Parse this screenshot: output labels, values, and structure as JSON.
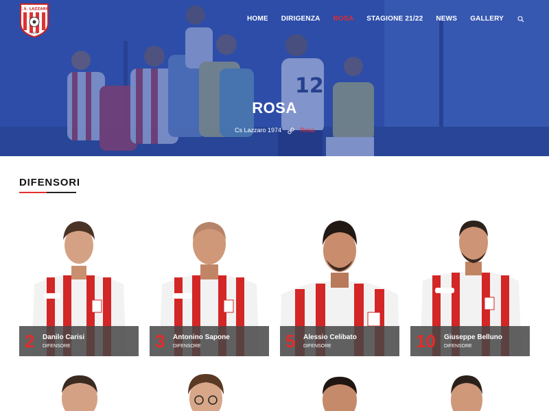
{
  "brand": {
    "logo_text": "C.S. LAZZARO",
    "logo_year": "1974"
  },
  "nav": {
    "items": [
      {
        "label": "HOME",
        "active": false
      },
      {
        "label": "DIRIGENZA",
        "active": false
      },
      {
        "label": "ROSA",
        "active": true
      },
      {
        "label": "STAGIONE 21/22",
        "active": false
      },
      {
        "label": "NEWS",
        "active": false
      },
      {
        "label": "GALLERY",
        "active": false
      }
    ],
    "search_icon": "search-icon"
  },
  "hero": {
    "title": "ROSA",
    "breadcrumb": {
      "home": "Cs Lazzaro 1974",
      "separator_icon": "link-icon",
      "current": "Rosa"
    }
  },
  "section": {
    "title": "DIFENSORI"
  },
  "players": [
    {
      "number": "2",
      "name": "Danilo Carisi",
      "role": "DIFENSORE"
    },
    {
      "number": "3",
      "name": "Antonino Sapone",
      "role": "DIFENSORE"
    },
    {
      "number": "5",
      "name": "Alessio Celibato",
      "role": "DIFENSORE"
    },
    {
      "number": "10",
      "name": "Giuseppe Belluno",
      "role": "DIFENSORE"
    }
  ],
  "colors": {
    "accent": "#e32c2c",
    "hero_blue": "#2f4fa0",
    "card_bar": "#464646"
  }
}
